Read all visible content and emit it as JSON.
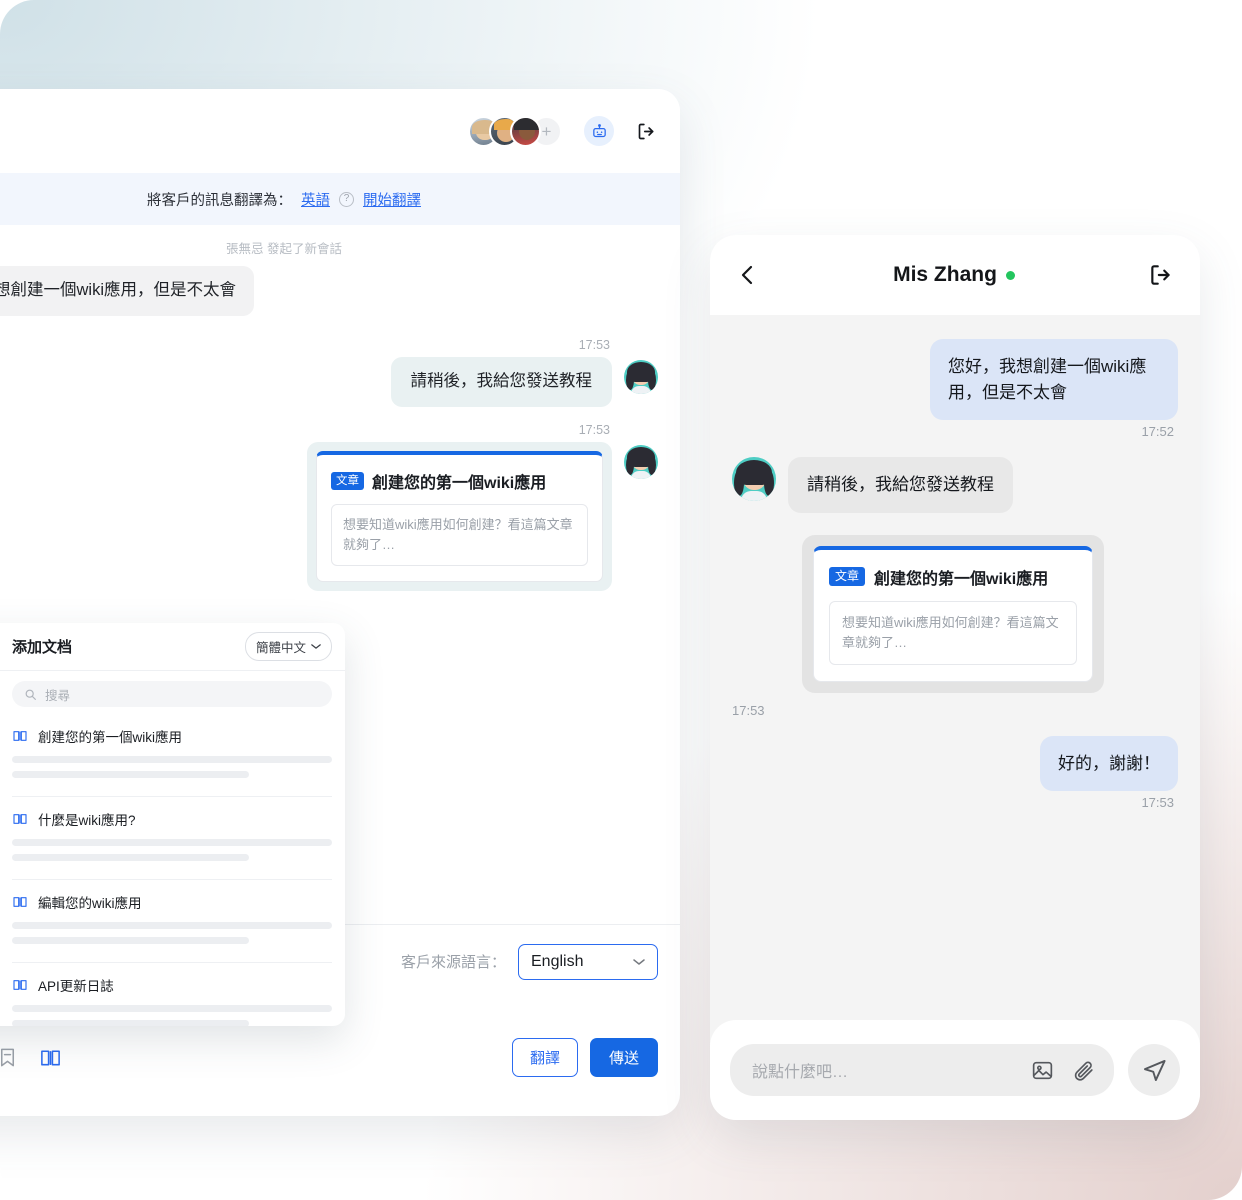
{
  "theme": {
    "accent": "#1668e3",
    "link": "#2b6bf0",
    "online": "#23c55e",
    "bubble_in_desktop": "#f2f2f3",
    "bubble_out_desktop": "#e9f1f2",
    "bubble_out_phone": "#dbe5f7",
    "bubble_in_phone": "#e8e8e8",
    "translate_bar_bg": "#f2f6fd"
  },
  "desktop": {
    "header": {
      "avatar_count_extra": "+",
      "bot_icon": "robot-icon",
      "exit_icon": "logout-icon"
    },
    "translate_bar": {
      "prefix": "將客戶的訊息翻譯為：",
      "language": "英語",
      "help_icon": "question-circle-icon",
      "action": "開始翻譯"
    },
    "system_note": "張無忌 發起了新會話",
    "messages": [
      {
        "side": "in",
        "text": "您好，我想創建一個wiki應用，但是不太會"
      },
      {
        "side": "out",
        "time": "17:53",
        "text": "請稍後，我給您發送教程"
      },
      {
        "side": "out",
        "time": "17:53",
        "card": {
          "tag": "文章",
          "title": "創建您的第一個wiki應用",
          "excerpt": "想要知道wiki應用如何創建？看這篇文章就夠了…"
        }
      }
    ],
    "source_language": {
      "label": "客戶來源語言：",
      "value": "English"
    },
    "toolbar_icons": [
      "attachment-icon",
      "quick-reply-icon",
      "bookmark-icon",
      "knowledge-base-icon"
    ],
    "footer_buttons": {
      "translate": "翻譯",
      "send": "傳送"
    }
  },
  "doc_panel": {
    "title": "添加文档",
    "language_selector": "簡體中文",
    "search_placeholder": "搜尋",
    "search_icon": "search-icon",
    "items": [
      {
        "icon": "book-icon",
        "title": "創建您的第一個wiki應用"
      },
      {
        "icon": "book-icon",
        "title": "什麼是wiki應用?"
      },
      {
        "icon": "book-icon",
        "title": "編輯您的wiki應用"
      },
      {
        "icon": "book-icon",
        "title": "API更新日誌"
      }
    ]
  },
  "phone": {
    "header": {
      "back_icon": "chevron-left-icon",
      "title": "Mis Zhang",
      "status": "online",
      "exit_icon": "logout-icon"
    },
    "messages": [
      {
        "side": "out",
        "text": "您好，我想創建一個wiki應用，但是不太會",
        "time": "17:52"
      },
      {
        "side": "in",
        "text": "請稍後，我給您發送教程"
      },
      {
        "side": "in",
        "time": "17:53",
        "card": {
          "tag": "文章",
          "title": "創建您的第一個wiki應用",
          "excerpt": "想要知道wiki應用如何創建？看這篇文章就夠了…"
        }
      },
      {
        "side": "out",
        "text": "好的，謝謝！",
        "time": "17:53"
      }
    ],
    "composer": {
      "placeholder": "說點什麼吧…",
      "image_icon": "image-icon",
      "attachment_icon": "paperclip-icon",
      "send_icon": "send-icon"
    }
  }
}
